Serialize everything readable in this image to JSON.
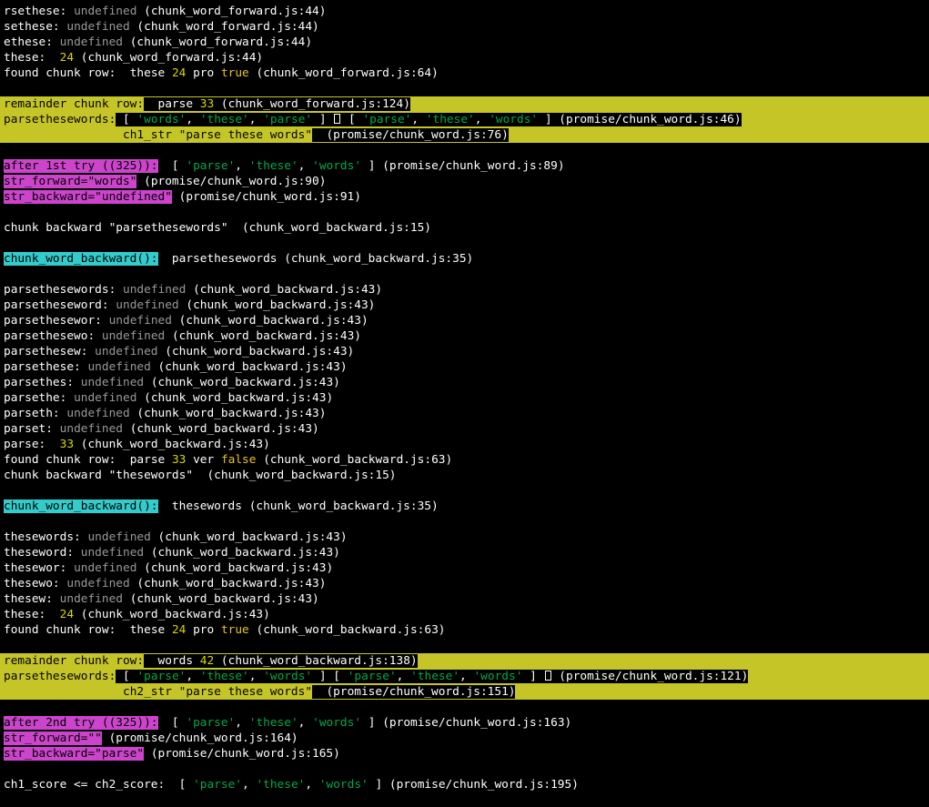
{
  "terminal": {
    "title": "browser devtools console output",
    "background": "#000000",
    "foreground": "#ffffff",
    "colors": {
      "gray": "#999999",
      "number_yellow": "#d7d700",
      "bool_yellow": "#e8c320",
      "string_green": "#00a84a",
      "highlight_yellow": "#c5c528",
      "highlight_magenta": "#cc44cc",
      "highlight_cyan": "#33cccc"
    }
  },
  "lines": [
    {
      "id": "l1",
      "label": "rsethese:",
      "value": "undefined",
      "source": "(chunk_word_forward.js:44)"
    },
    {
      "id": "l2",
      "label": "sethese:",
      "value": "undefined",
      "source": "(chunk_word_forward.js:44)"
    },
    {
      "id": "l3",
      "label": "ethese:",
      "value": "undefined",
      "source": "(chunk_word_forward.js:44)"
    },
    {
      "id": "l4",
      "label": "these:",
      "value": "24",
      "source": "(chunk_word_forward.js:44)"
    },
    {
      "id": "l5",
      "label": "found chunk row:",
      "word": "these",
      "number": "24",
      "kind": "pro",
      "bool": "true",
      "source": "(chunk_word_forward.js:64)"
    },
    {
      "id": "l6",
      "label": "remainder chunk row:",
      "word": "parse",
      "number": "33",
      "source": "(chunk_word_forward.js:124)"
    },
    {
      "id": "l7",
      "label": "parsethesewords:",
      "array_a": [
        "'words'",
        "'these'",
        "'parse'"
      ],
      "array_b": [
        "'parse'",
        "'these'",
        "'words'"
      ],
      "source": "(promise/chunk_word.js:46)"
    },
    {
      "id": "l8",
      "label": "ch1_str",
      "value": "\"parse these words\"",
      "source": "(promise/chunk_word.js:76)"
    },
    {
      "id": "l9",
      "label": "after 1st try ((325)):",
      "array": [
        "'parse'",
        "'these'",
        "'words'"
      ],
      "source": "(promise/chunk_word.js:89)"
    },
    {
      "id": "l10",
      "label": "str_forward=\"words\"",
      "source": "(promise/chunk_word.js:90)"
    },
    {
      "id": "l11",
      "label": "str_backward=\"undefined\"",
      "source": "(promise/chunk_word.js:91)"
    },
    {
      "id": "l12",
      "label": "chunk backward \"parsethesewords\"",
      "source": "(chunk_word_backward.js:15)"
    },
    {
      "id": "l13",
      "label": "chunk_word_backward():",
      "value": "parsethesewords",
      "source": "(chunk_word_backward.js:35)"
    },
    {
      "id": "l14",
      "label": "parsethesewords:",
      "value": "undefined",
      "source": "(chunk_word_backward.js:43)"
    },
    {
      "id": "l15",
      "label": "parsetheseword:",
      "value": "undefined",
      "source": "(chunk_word_backward.js:43)"
    },
    {
      "id": "l16",
      "label": "parsethesewor:",
      "value": "undefined",
      "source": "(chunk_word_backward.js:43)"
    },
    {
      "id": "l17",
      "label": "parsethesewo:",
      "value": "undefined",
      "source": "(chunk_word_backward.js:43)"
    },
    {
      "id": "l18",
      "label": "parsethesew:",
      "value": "undefined",
      "source": "(chunk_word_backward.js:43)"
    },
    {
      "id": "l19",
      "label": "parsethese:",
      "value": "undefined",
      "source": "(chunk_word_backward.js:43)"
    },
    {
      "id": "l20",
      "label": "parsethes:",
      "value": "undefined",
      "source": "(chunk_word_backward.js:43)"
    },
    {
      "id": "l21",
      "label": "parsethe:",
      "value": "undefined",
      "source": "(chunk_word_backward.js:43)"
    },
    {
      "id": "l22",
      "label": "parseth:",
      "value": "undefined",
      "source": "(chunk_word_backward.js:43)"
    },
    {
      "id": "l23",
      "label": "parset:",
      "value": "undefined",
      "source": "(chunk_word_backward.js:43)"
    },
    {
      "id": "l24",
      "label": "parse:",
      "value": "33",
      "source": "(chunk_word_backward.js:43)"
    },
    {
      "id": "l25",
      "label": "found chunk row:",
      "word": "parse",
      "number": "33",
      "kind": "ver",
      "bool": "false",
      "source": "(chunk_word_backward.js:63)"
    },
    {
      "id": "l26",
      "label": "chunk backward \"thesewords\"",
      "source": "(chunk_word_backward.js:15)"
    },
    {
      "id": "l27",
      "label": "chunk_word_backward():",
      "value": "thesewords",
      "source": "(chunk_word_backward.js:35)"
    },
    {
      "id": "l28",
      "label": "thesewords:",
      "value": "undefined",
      "source": "(chunk_word_backward.js:43)"
    },
    {
      "id": "l29",
      "label": "theseword:",
      "value": "undefined",
      "source": "(chunk_word_backward.js:43)"
    },
    {
      "id": "l30",
      "label": "thesewor:",
      "value": "undefined",
      "source": "(chunk_word_backward.js:43)"
    },
    {
      "id": "l31",
      "label": "thesewo:",
      "value": "undefined",
      "source": "(chunk_word_backward.js:43)"
    },
    {
      "id": "l32",
      "label": "thesew:",
      "value": "undefined",
      "source": "(chunk_word_backward.js:43)"
    },
    {
      "id": "l33",
      "label": "these:",
      "value": "24",
      "source": "(chunk_word_backward.js:43)"
    },
    {
      "id": "l34",
      "label": "found chunk row:",
      "word": "these",
      "number": "24",
      "kind": "pro",
      "bool": "true",
      "source": "(chunk_word_backward.js:63)"
    },
    {
      "id": "l35",
      "label": "remainder chunk row:",
      "word": "words",
      "number": "42",
      "source": "(chunk_word_backward.js:138)"
    },
    {
      "id": "l36",
      "label": "parsethesewords:",
      "array_a": [
        "'parse'",
        "'these'",
        "'words'"
      ],
      "array_b": [
        "'parse'",
        "'these'",
        "'words'"
      ],
      "source": "(promise/chunk_word.js:121)"
    },
    {
      "id": "l37",
      "label": "ch2_str",
      "value": "\"parse these words\"",
      "source": "(promise/chunk_word.js:151)"
    },
    {
      "id": "l38",
      "label": "after 2nd try ((325)):",
      "array": [
        "'parse'",
        "'these'",
        "'words'"
      ],
      "source": "(promise/chunk_word.js:163)"
    },
    {
      "id": "l39",
      "label": "str_forward=\"\"",
      "source": "(promise/chunk_word.js:164)"
    },
    {
      "id": "l40",
      "label": "str_backward=\"parse\"",
      "source": "(promise/chunk_word.js:165)"
    },
    {
      "id": "l41",
      "label": "ch1_score <= ch2_score:",
      "array": [
        "'parse'",
        "'these'",
        "'words'"
      ],
      "source": "(promise/chunk_word.js:195)"
    }
  ],
  "punctuation": {
    "bracket_open": "[",
    "bracket_close": "]",
    "comma": ",",
    "space": " "
  }
}
